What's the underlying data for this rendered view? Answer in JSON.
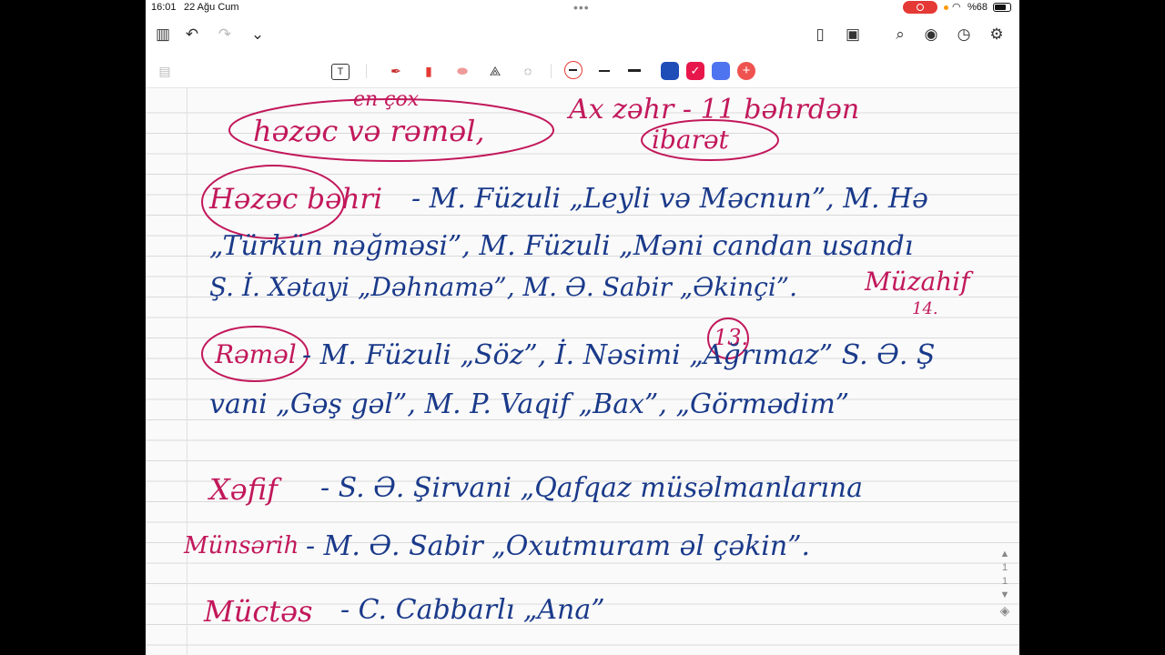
{
  "status": {
    "time": "16:01",
    "date": "22 Ağu Cum",
    "battery": "%68"
  },
  "toolbar": {
    "icons": [
      "sidebar-icon",
      "undo-icon",
      "redo-icon",
      "chevron-down-icon",
      "new-page-icon",
      "image-icon",
      "search-doc-icon",
      "read-mode-icon",
      "clock-icon",
      "gear-icon"
    ]
  },
  "tools": {
    "icons": [
      "text-tool-icon",
      "pen-tool-icon",
      "highlighter-tool-icon",
      "eraser-tool-icon",
      "shapes-tool-icon",
      "lasso-tool-icon"
    ],
    "colors": [
      "#1e4db7",
      "#e8174b",
      "#4f74f0"
    ]
  },
  "notes": {
    "top_annot_1": "en çox",
    "top_label": "həzəc və rəməl,",
    "top_right": "Ax zəhr - 11 bəhrdən",
    "top_right_2": "ibarət",
    "hezec_label": "Həzəc bəhri",
    "hezec_line1": "- M. Füzuli „Leyli və Məcnun”, M. Hə",
    "hezec_line2": "„Türkün nəğməsi”, M. Füzuli „Məni candan usandı",
    "hezec_line3": "Ş. İ. Xətayi „Dəhnamə”, M. Ə. Sabir „Əkinçi”.",
    "hezec_annot": "Müzahif",
    "hezec_annot2": "14.",
    "annot_13": "13.",
    "remel_label": "Rəməl",
    "remel_line1": "- M. Füzuli „Söz”, İ. Nəsimi „Ağrımaz” S. Ə. Ş",
    "remel_line2": "vani „Gəş gəl”, M. P. Vaqif „Bax”, „Görmədim”",
    "xefif_label": "Xəfif",
    "xefif_line": "- S. Ə. Şirvani „Qafqaz müsəlmanlarına",
    "munserih_label": "Münsərih",
    "munserih_line": "- M. Ə. Sabir „Oxutmuram əl çəkin”.",
    "muctes_label": "Müctəs",
    "muctes_line": "- C. Cabbarlı „Ana”"
  },
  "pagination": {
    "current": "1",
    "total": "1"
  }
}
